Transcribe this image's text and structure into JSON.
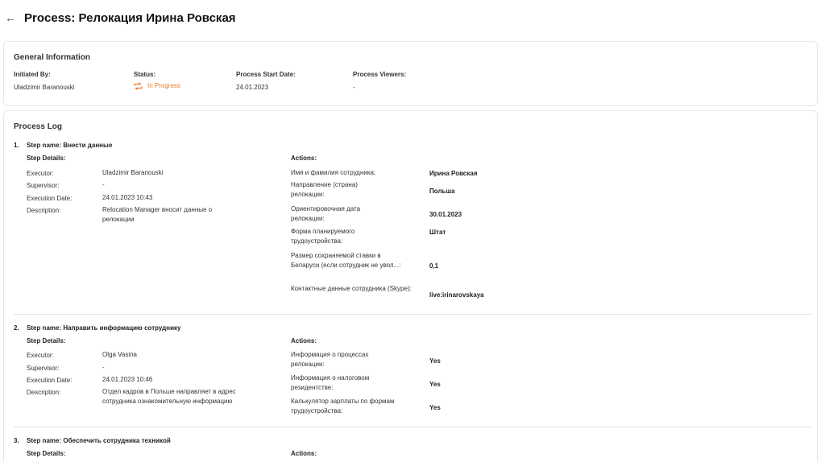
{
  "header": {
    "back_icon": "←",
    "title": "Process: Релокация Ирина Ровская"
  },
  "general": {
    "title": "General Information",
    "initiated_by_label": "Initiated By:",
    "initiated_by": "Uladzimir Baranouski",
    "status_label": "Status:",
    "status": "In Progress",
    "status_color": "#f07a28",
    "start_date_label": "Process Start Date:",
    "start_date": "24.01.2023",
    "viewers_label": "Process Viewers:",
    "viewers": "-"
  },
  "log": {
    "title": "Process Log",
    "steps": [
      {
        "num": "1.",
        "name": "Step name: Внести данные",
        "details_head": "Step Details:",
        "actions_head": "Actions:",
        "executor_label": "Executor:",
        "executor": "Uladzimir Baranouski",
        "supervisor_label": "Supervisor:",
        "supervisor": "-",
        "date_label": "Execution Date:",
        "date": "24.01.2023 10:43",
        "desc_label": "Description:",
        "desc": "Relocation Manager вносит данные о релокации",
        "actions": [
          {
            "label": "Имя и фамилия сотрудника:",
            "value": "Ирина Ровская"
          },
          {
            "label": "Направление (страна) релокации:",
            "value": "Польша"
          },
          {
            "label": "Ориентировочная дата релокации:",
            "value": "30.01.2023"
          },
          {
            "label": "Форма планируемого трудоустройства:",
            "value": "Штат"
          },
          {
            "label": "Размер сохраняемой ставки в Беларуси (если сотрудник не увол...:",
            "value": "0,1"
          },
          {
            "label": "Контактные данные сотрудника (Skype):",
            "value": "live:irinarovskaya"
          }
        ]
      },
      {
        "num": "2.",
        "name": "Step name: Направить информацию сотруднику",
        "details_head": "Step Details:",
        "actions_head": "Actions:",
        "executor_label": "Executor:",
        "executor": "Olga Vasina",
        "supervisor_label": "Supervisor:",
        "supervisor": "-",
        "date_label": "Execution Date:",
        "date": "24.01.2023 10:46",
        "desc_label": "Description:",
        "desc": "Отдел кадров в Польше направляет в адрес сотрудника ознакомительную информацию",
        "actions": [
          {
            "label": "Информация о процессах релокации:",
            "value": "Yes"
          },
          {
            "label": "Информация о налоговом резидентстве:",
            "value": "Yes"
          },
          {
            "label": "Калькулятор зарплаты по формам трудоустройства:",
            "value": "Yes"
          }
        ]
      },
      {
        "num": "3.",
        "name": "Step name: Обеспечить сотрудника техникой",
        "details_head": "Step Details:",
        "actions_head": "Actions:"
      }
    ]
  }
}
